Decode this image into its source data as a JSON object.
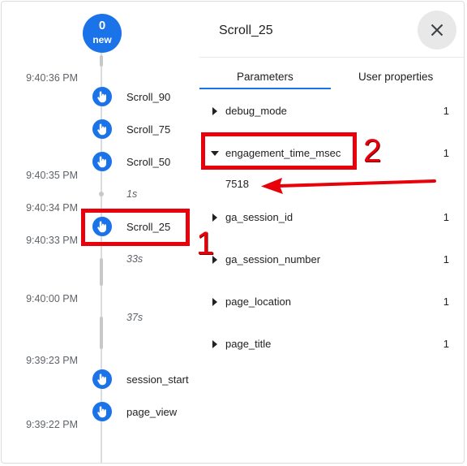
{
  "timeline": {
    "new_count": "0",
    "new_label": "new",
    "timestamps": [
      "9:40:36 PM",
      "9:40:35 PM",
      "9:40:34 PM",
      "9:40:33 PM",
      "9:40:00 PM",
      "9:39:23 PM",
      "9:39:22 PM"
    ],
    "events": [
      "Scroll_90",
      "Scroll_75",
      "Scroll_50",
      "Scroll_25",
      "session_start",
      "page_view"
    ],
    "gaps": [
      "1s",
      "33s",
      "37s"
    ]
  },
  "details": {
    "title": "Scroll_25",
    "tabs": [
      "Parameters",
      "User properties"
    ],
    "params": [
      {
        "name": "debug_mode",
        "count": "1"
      },
      {
        "name": "engagement_time_msec",
        "count": "1",
        "value": "7518"
      },
      {
        "name": "ga_session_id",
        "count": "1"
      },
      {
        "name": "ga_session_number",
        "count": "1"
      },
      {
        "name": "page_location",
        "count": "1"
      },
      {
        "name": "page_title",
        "count": "1"
      }
    ]
  },
  "annotations": {
    "label_1": "1",
    "label_2": "2"
  },
  "colors": {
    "accent": "#1a73e8",
    "highlight": "#e8000b"
  },
  "icons": {
    "event": "touch-hand-icon",
    "close": "close-icon"
  }
}
